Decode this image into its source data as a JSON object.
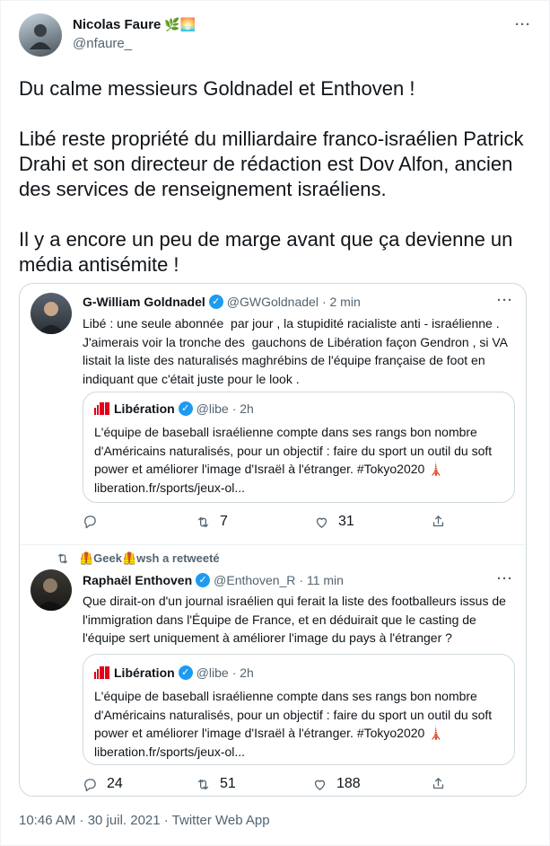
{
  "tweet": {
    "author_name": "Nicolas Faure",
    "author_emoji": "🌿🌅",
    "author_handle": "@nfaure_",
    "text": "Du calme messieurs Goldnadel et Enthoven !\n\nLibé reste propriété du milliardaire franco-israélien Patrick Drahi et son directeur de rédaction est Dov Alfon, ancien des services de renseignement israéliens.\n\nIl y a encore un peu de marge avant que ça devienne un média antisémite !",
    "timestamp": "10:46 AM · 30 juil. 2021 · Twitter Web App"
  },
  "quote1": {
    "author_name": "G-William Goldnadel",
    "author_handle": "@GWGoldnadel",
    "time": "· 2 min",
    "text": "Libé : une seule abonnée  par jour , la stupidité racialiste anti - israélienne .\nJ'aimerais voir la tronche des  gauchons de Libération façon Gendron , si VA\nlistait la liste des naturalisés maghrébins de l'équipe française de foot en\nindiquant que c'était juste pour le look .",
    "nested": {
      "author_name": "Libération",
      "author_handle": "@libe",
      "time": "· 2h",
      "text": "L'équipe de baseball israélienne compte dans ses rangs bon nombre\nd'Américains naturalisés, pour un objectif : faire du sport un outil du soft\npower et améliorer l'image d'Israël à l'étranger. #Tokyo2020 🗼\nliberation.fr/sports/jeux-ol..."
    },
    "retweets": "7",
    "likes": "31"
  },
  "retweet_line": "🦺Geek🦺wsh a retweeté",
  "quote2": {
    "author_name": "Raphaël Enthoven",
    "author_handle": "@Enthoven_R",
    "time": "· 11 min",
    "text": "Que dirait-on d'un journal israélien qui ferait la liste des footballeurs issus de\nl'immigration dans l'Équipe de France, et en déduirait que le casting de\nl'équipe sert uniquement à améliorer l'image du pays à l'étranger ?",
    "nested": {
      "author_name": "Libération",
      "author_handle": "@libe",
      "time": "· 2h",
      "text": "L'équipe de baseball israélienne compte dans ses rangs bon nombre\nd'Américains naturalisés, pour un objectif : faire du sport un outil du soft\npower et améliorer l'image d'Israël à l'étranger. #Tokyo2020 🗼\nliberation.fr/sports/jeux-ol..."
    },
    "replies": "24",
    "retweets": "51",
    "likes": "188"
  },
  "more_label": "···",
  "colors": {
    "verified": "#1d9bf0",
    "secondary_text": "#536471",
    "border": "#cfd9de"
  },
  "icons": [
    "reply-icon",
    "retweet-icon",
    "like-icon",
    "share-icon",
    "verified-icon",
    "more-icon"
  ]
}
